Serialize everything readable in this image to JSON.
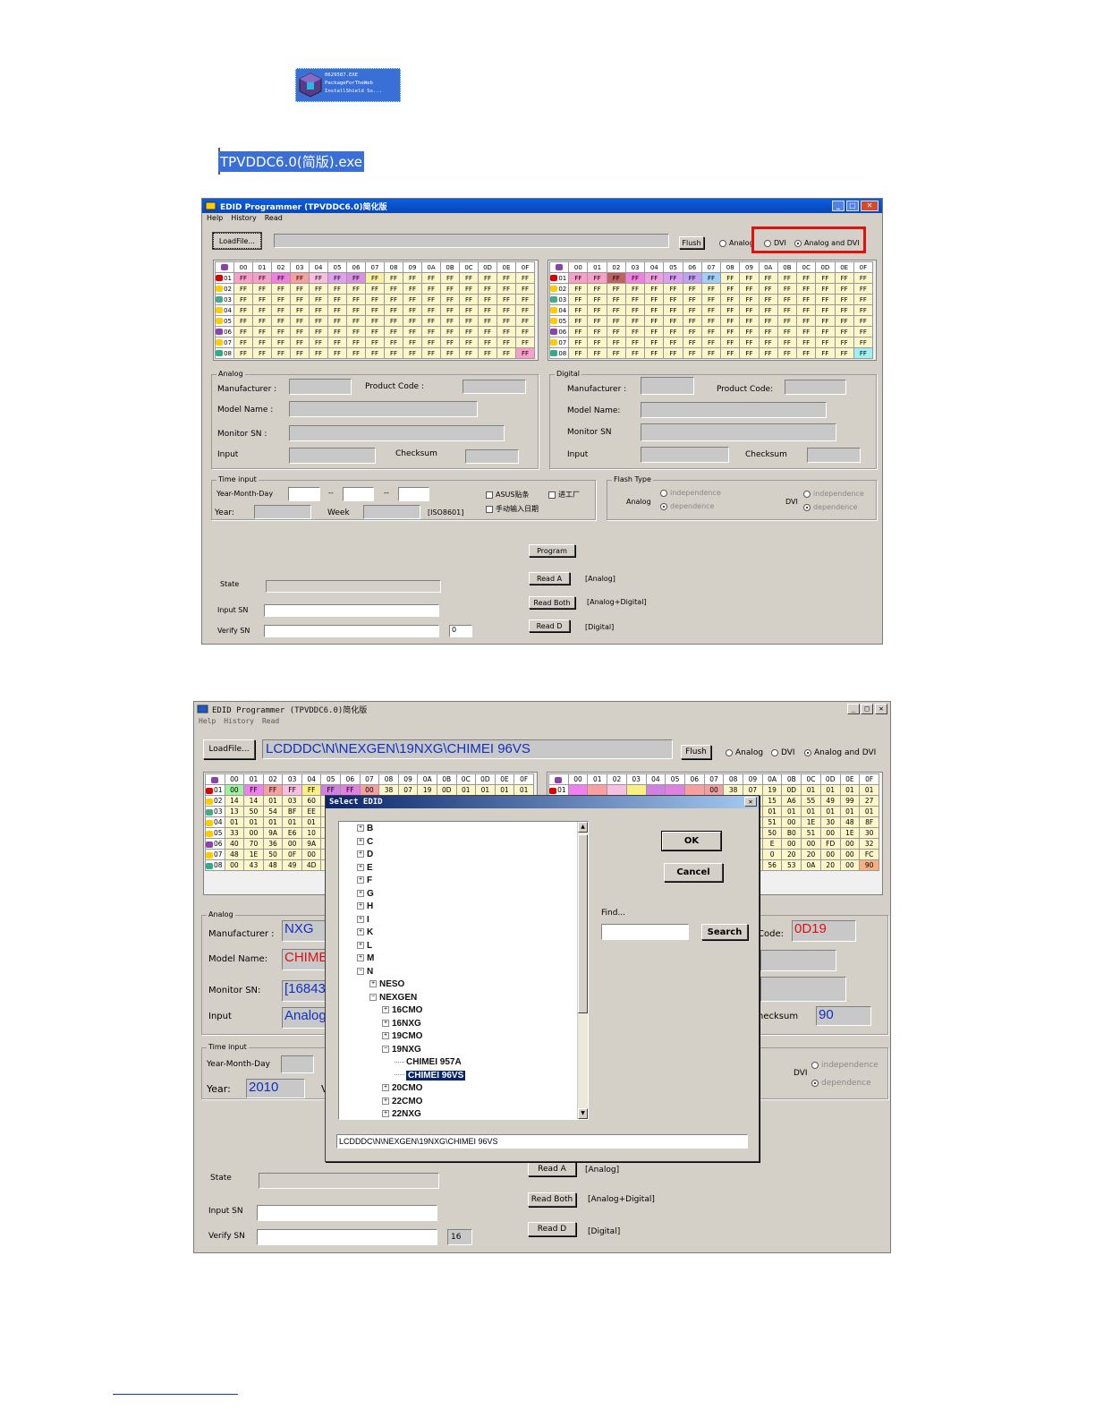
{
  "installer": {
    "lines": [
      "0629587.EXE",
      "PackageForTheWeb",
      "InstallShield So..."
    ],
    "icon": "installer-box-icon"
  },
  "exe_label": "TPVDDC6.0(简版).exe",
  "window1": {
    "title": "EDID Programmer (TPVDDC6.0)简化版",
    "menu": [
      "Help",
      "History",
      "Read"
    ],
    "loadfile": "LoadFile...",
    "flush": "Flush",
    "radios": [
      "Analog",
      "DVI",
      "Analog and DVI"
    ],
    "selected_radio": "Analog and DVI",
    "grid_header": [
      "00",
      "01",
      "02",
      "03",
      "04",
      "05",
      "06",
      "07",
      "08",
      "09",
      "0A",
      "0B",
      "0C",
      "0D",
      "0E",
      "0F"
    ],
    "rows": [
      "01",
      "02",
      "03",
      "04",
      "05",
      "06",
      "07",
      "08"
    ],
    "cell_value": "FF",
    "analog": {
      "title": "Analog",
      "manufacturer": "Manufacturer :",
      "product_code": "Product Code :",
      "model_name": "Model Name :",
      "monitor_sn": "Monitor SN :",
      "input": "Input",
      "checksum": "Checksum"
    },
    "digital": {
      "title": "Digital",
      "manufacturer": "Manufacturer :",
      "product_code": "Product Code:",
      "model_name": "Model Name:",
      "monitor_sn": "Monitor SN",
      "input": "Input",
      "checksum": "Checksum"
    },
    "time": {
      "title": "Time input",
      "ymd": "Year-Month-Day",
      "dash": "--",
      "year": "Year:",
      "week": "Week",
      "iso": "[ISO8601]",
      "asus": "ASUS贴条",
      "jgc": "进工厂",
      "manual": "手动输入日期"
    },
    "flash": {
      "title": "Flash Type",
      "analog": "Analog",
      "dvi": "DVI",
      "independence": "independence",
      "dependence": "dependence"
    },
    "program": "Program",
    "read_a": "Read A",
    "read_both": "Read Both",
    "read_d": "Read D",
    "read_a_note": "[Analog]",
    "read_both_note": "[Analog+Digital]",
    "read_d_note": "[Digital]",
    "state": "State",
    "input_sn": "Input SN",
    "verify_sn": "Verify SN",
    "verify_count": "0"
  },
  "window2": {
    "title": "EDID Programmer (TPVDDC6.0)简化版",
    "menu": [
      "Help",
      "History",
      "Read"
    ],
    "loadfile": "LoadFile...",
    "path": "LCDDDC\\N\\NEXGEN\\19NXG\\CHIMEI 96VS",
    "flush": "Flush",
    "radios": [
      "Analog",
      "DVI",
      "Analog and DVI"
    ],
    "grid_header": [
      "00",
      "01",
      "02",
      "03",
      "04",
      "05",
      "06",
      "07",
      "08",
      "09",
      "0A",
      "0B",
      "0C",
      "0D",
      "0E",
      "0F"
    ],
    "left_rows": [
      [
        "01",
        "00",
        "FF",
        "FF",
        "FF",
        "FF",
        "FF",
        "FF",
        "00",
        "38",
        "07",
        "19",
        "0D",
        "01",
        "01",
        "01",
        "01"
      ],
      [
        "02",
        "14",
        "14",
        "01",
        "03",
        "60"
      ],
      [
        "03",
        "13",
        "50",
        "54",
        "BF",
        "EE"
      ],
      [
        "04",
        "01",
        "01",
        "01",
        "01",
        "01"
      ],
      [
        "05",
        "33",
        "00",
        "9A",
        "E6",
        "10"
      ],
      [
        "06",
        "40",
        "70",
        "36",
        "00",
        "9A"
      ],
      [
        "07",
        "48",
        "1E",
        "50",
        "0F",
        "00"
      ],
      [
        "08",
        "00",
        "43",
        "48",
        "49",
        "4D"
      ]
    ],
    "right_rows": [
      [
        "00",
        "38",
        "07",
        "19",
        "0D",
        "01",
        "01",
        "01",
        "01"
      ],
      [
        "15",
        "A6",
        "55",
        "49",
        "99",
        "27"
      ],
      [
        "01",
        "01",
        "01",
        "01",
        "01",
        "01"
      ],
      [
        "A",
        "51",
        "00",
        "1E",
        "30",
        "48",
        "8F"
      ],
      [
        "50",
        "B0",
        "51",
        "00",
        "1E",
        "30"
      ],
      [
        "E",
        "00",
        "00",
        "FD",
        "00",
        "32"
      ],
      [
        "0",
        "20",
        "20",
        "00",
        "00",
        "FC"
      ],
      [
        "5",
        "56",
        "53",
        "0A",
        "20",
        "00",
        "90"
      ]
    ],
    "analog": {
      "title": "Analog",
      "manufacturer": "Manufacturer :",
      "manufacturer_value": "NXG",
      "model_name": "Model Name:",
      "model_value": "CHIME",
      "monitor_sn": "Monitor SN:",
      "monitor_value": "[16843",
      "input": "Input",
      "input_value": "Analog"
    },
    "code_label": "Code:",
    "product_code_value": "0D19",
    "checksum_label": "hecksum",
    "checksum_value": "90",
    "time": {
      "title": "Time input",
      "ymd": "Year-Month-Day",
      "year": "Year:",
      "year_value": "2010",
      "v": "V"
    },
    "flash": {
      "dvi": "DVI",
      "independence": "independence",
      "dependence": "dependence"
    },
    "read_a": "Read A",
    "read_both": "Read Both",
    "read_d": "Read D",
    "read_a_note": "[Analog]",
    "read_both_note": "[Analog+Digital]",
    "read_d_note": "[Digital]",
    "state": "State",
    "input_sn": "Input SN",
    "verify_sn": "Verify SN",
    "verify_count": "16"
  },
  "dialog": {
    "title": "Select EDID",
    "ok": "OK",
    "cancel": "Cancel",
    "find": "Find...",
    "search": "Search",
    "letters": [
      "B",
      "C",
      "D",
      "E",
      "F",
      "G",
      "H",
      "I",
      "K",
      "L",
      "M",
      "N"
    ],
    "n_children": [
      "NESO",
      "NEXGEN"
    ],
    "nexgen_children": [
      "16CMO",
      "16NXG",
      "19CMO",
      "19NXG"
    ],
    "nxg19_children": [
      "CHIMEI 957A",
      "CHIMEI 96VS"
    ],
    "more": [
      "20CMO",
      "22CMO",
      "22NXG"
    ],
    "selected": "CHIMEI 96VS",
    "path": "LCDDDC\\N\\NEXGEN\\19NXG\\CHIMEI 96VS"
  }
}
